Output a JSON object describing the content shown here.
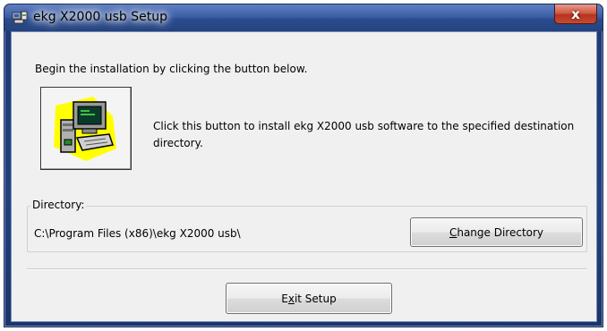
{
  "window": {
    "title": "ekg X2000 usb Setup",
    "close_glyph": "x",
    "icon": "setup-computer-icon"
  },
  "intro_text": "Begin the installation by clicking the button below.",
  "install": {
    "icon": "install-computer-icon",
    "description": "Click this button to install ekg X2000 usb software to the specified destination directory."
  },
  "directory": {
    "legend": "Directory:",
    "path": "C:\\Program Files (x86)\\ekg X2000 usb\\",
    "change_button": {
      "accel": "C",
      "rest": "hange Directory"
    }
  },
  "exit_button": {
    "before": "E",
    "accel": "x",
    "after": "it Setup"
  },
  "colors": {
    "titlebar": "#2a4b8e",
    "close_button": "#c44b33",
    "client_background": "#f0f0f0",
    "icon_yellow": "#ffff00"
  }
}
